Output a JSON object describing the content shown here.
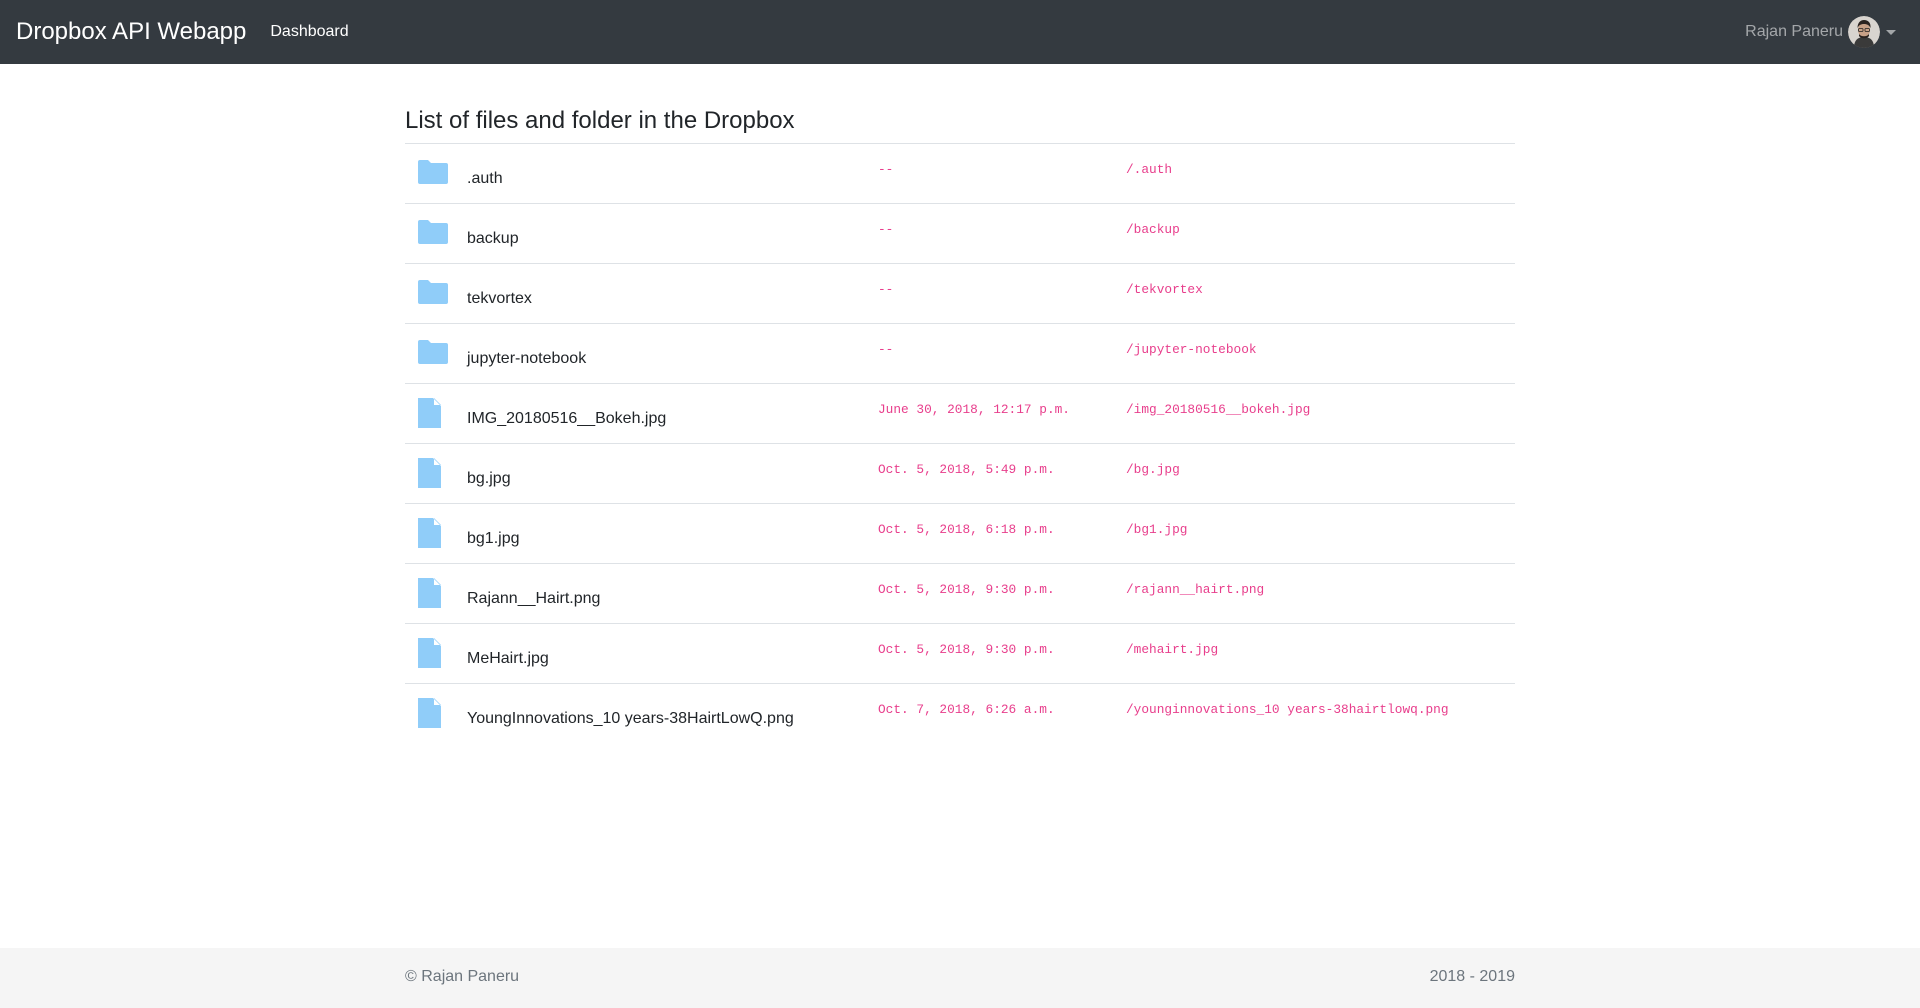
{
  "navbar": {
    "brand": "Dropbox API Webapp",
    "dashboard_link": "Dashboard",
    "user_name": "Rajan Paneru"
  },
  "main": {
    "title": "List of files and folder in the Dropbox",
    "items": [
      {
        "type": "folder",
        "name": ".auth",
        "modified": "--",
        "path": "/.auth"
      },
      {
        "type": "folder",
        "name": "backup",
        "modified": "--",
        "path": "/backup"
      },
      {
        "type": "folder",
        "name": "tekvortex",
        "modified": "--",
        "path": "/tekvortex"
      },
      {
        "type": "folder",
        "name": "jupyter-notebook",
        "modified": "--",
        "path": "/jupyter-notebook"
      },
      {
        "type": "file",
        "name": "IMG_20180516__Bokeh.jpg",
        "modified": "June 30, 2018, 12:17 p.m.",
        "path": "/img_20180516__bokeh.jpg"
      },
      {
        "type": "file",
        "name": "bg.jpg",
        "modified": "Oct. 5, 2018, 5:49 p.m.",
        "path": "/bg.jpg"
      },
      {
        "type": "file",
        "name": "bg1.jpg",
        "modified": "Oct. 5, 2018, 6:18 p.m.",
        "path": "/bg1.jpg"
      },
      {
        "type": "file",
        "name": "Rajann__Hairt.png",
        "modified": "Oct. 5, 2018, 9:30 p.m.",
        "path": "/rajann__hairt.png"
      },
      {
        "type": "file",
        "name": "MeHairt.jpg",
        "modified": "Oct. 5, 2018, 9:30 p.m.",
        "path": "/mehairt.jpg"
      },
      {
        "type": "file",
        "name": "YoungInnovations_10 years-38HairtLowQ.png",
        "modified": "Oct. 7, 2018, 6:26 a.m.",
        "path": "/younginnovations_10 years-38hairtlowq.png"
      }
    ]
  },
  "footer": {
    "copyright": "© Rajan Paneru",
    "years": "2018 - 2019"
  },
  "colors": {
    "navbar_bg": "#343a40",
    "icon_blue": "#90cdf9",
    "code_pink": "#e83e8c",
    "footer_bg": "#f5f5f5"
  },
  "icons": {
    "folder": "folder-icon",
    "file": "file-icon"
  }
}
